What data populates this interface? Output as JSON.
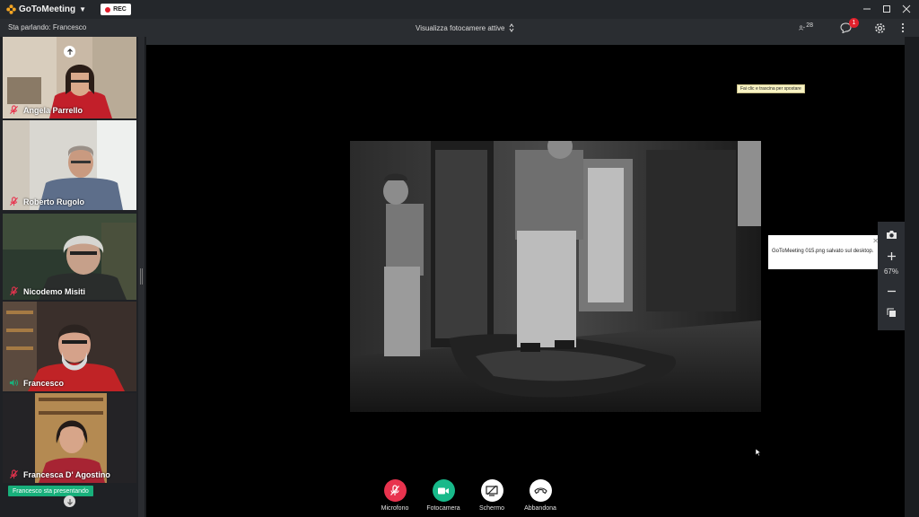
{
  "app": {
    "name": "GoToMeeting",
    "rec_label": "REC"
  },
  "toolbar": {
    "speaking": "Sta parlando: Francesco",
    "camera_select": "Visualizza fotocamere attive",
    "participants_count": "28",
    "chat_badge": "1"
  },
  "participants": [
    {
      "name": "Angela Parrello",
      "mic": "muted"
    },
    {
      "name": "Roberto Rugolo",
      "mic": "muted"
    },
    {
      "name": "Nicodemo Misiti",
      "mic": "muted"
    },
    {
      "name": "Francesco",
      "mic": "speaking"
    },
    {
      "name": "Francesca D'  Agostino",
      "mic": "muted"
    }
  ],
  "presenting_label": "Francesco sta presentando",
  "stage": {
    "drag_tooltip": "Fai clic e trascina per spostare",
    "notification": "GoToMeeting 015.png salvato sul desktop.",
    "zoom": "67%"
  },
  "controls": [
    {
      "label": "Microfono",
      "color": "#e8334e",
      "icon": "mic-off-icon"
    },
    {
      "label": "Fotocamera",
      "color": "#18b98a",
      "icon": "camera-icon"
    },
    {
      "label": "Schermo",
      "color": "#ffffff",
      "icon": "screen-share-icon"
    },
    {
      "label": "Abbandona",
      "color": "#ffffff",
      "icon": "hang-up-icon"
    }
  ],
  "colors": {
    "accent_orange": "#f5a623",
    "muted_red": "#e8334e",
    "speaking_green": "#18b07b"
  }
}
